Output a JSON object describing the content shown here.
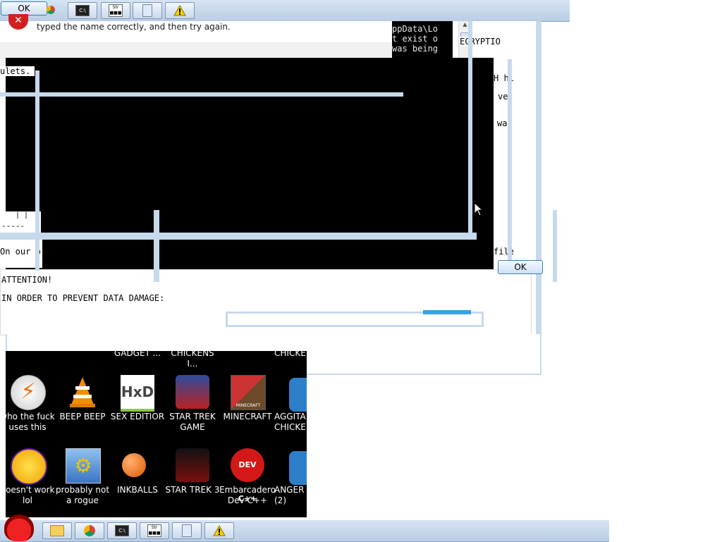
{
  "top_taskbar": {
    "ok_button": "OK"
  },
  "error_dialog": {
    "message": "typed the name correctly, and then try again."
  },
  "console": {
    "lines": [
      "ppData\\Lo",
      "t exist o",
      "was being"
    ],
    "left_fragment": "ulets.",
    "right_fragments": [
      "ECRYPTIO",
      "H hi",
      "ve",
      "way",
      "file"
    ]
  },
  "notepad": {
    "ticks": "| |",
    "dashes": "-----",
    "line1": "On our p",
    "line2": "ATTENTION!",
    "line3": "IN ORDER TO PREVENT DATA DAMAGE:"
  },
  "ok_dialog": {
    "button": "OK"
  },
  "desktop_icons": [
    {
      "label": "GADGET ..."
    },
    {
      "label": "CHICKENS I..."
    },
    {
      "label": "CHICKE"
    },
    {
      "label": "who the fuck uses this"
    },
    {
      "label": "BEEP BEEP"
    },
    {
      "label": "SEX EDITIOR"
    },
    {
      "label": "STAR TREK GAME"
    },
    {
      "label": "MINECRAFT"
    },
    {
      "label": "AGGITA CHICKE"
    },
    {
      "label": "doesn't work lol"
    },
    {
      "label": "probably not a rogue"
    },
    {
      "label": "INKBALLS"
    },
    {
      "label": "STAR TREK 3"
    },
    {
      "label": "Embarcadero Dev-C++"
    },
    {
      "label": "ANGER (2)"
    }
  ],
  "icon_texts": {
    "hxd": "HxD",
    "devcpp": "DEV C++",
    "minecraft": "MINECRAFT"
  },
  "icon_names": [
    "start-orb-icon",
    "explorer-icon",
    "chrome-icon",
    "cmd-icon",
    "script-icon",
    "notepad-icon",
    "warning-icon"
  ],
  "colors": {
    "taskbar": "#c9d9ec",
    "console": "#000000",
    "desktop": "#000000"
  }
}
